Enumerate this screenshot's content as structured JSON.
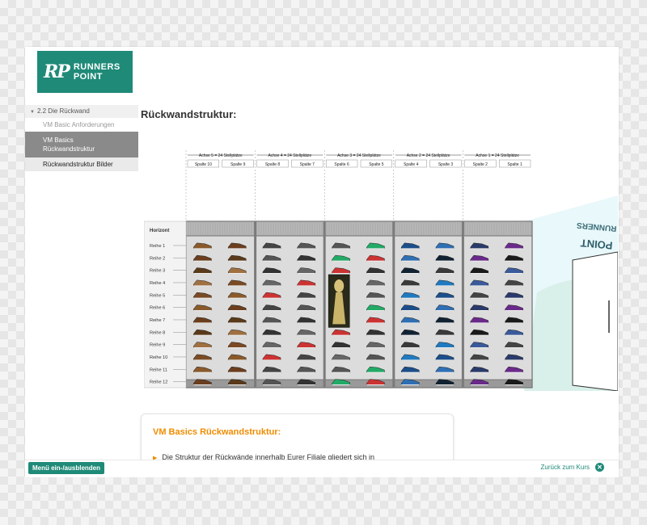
{
  "brand": {
    "mark": "RP",
    "line1": "RUNNERS",
    "line2": "POINT",
    "color": "#1f8a78"
  },
  "sidebar": {
    "section": "2.2 Die Rückwand",
    "items": [
      {
        "label": "VM Basic Anforderungen",
        "state": "normal"
      },
      {
        "label_lines": [
          "VM Basics",
          "Rückwandstruktur"
        ],
        "state": "active"
      },
      {
        "label": "Rückwandstruktur Bilder",
        "state": "sub"
      }
    ]
  },
  "page_title": "Rückwandstruktur:",
  "diagram": {
    "axes": [
      {
        "label": "Achse 5 = 24 Stellplätze",
        "columns": [
          "Spalte 10",
          "Spalte 9"
        ]
      },
      {
        "label": "Achse 4 = 24 Stellplätze",
        "columns": [
          "Spalte 8",
          "Spalte 7"
        ]
      },
      {
        "label": "Achse 3 = 24 Stellplätze",
        "columns": [
          "Spalte 6",
          "Spalte 5"
        ]
      },
      {
        "label": "Achse 2 = 24 Stellplätze",
        "columns": [
          "Spalte 4",
          "Spalte 3"
        ]
      },
      {
        "label": "Achse 1 = 24 Stellplätze",
        "columns": [
          "Spalte 2",
          "Spalte 1"
        ]
      }
    ],
    "horizont_label": "Horizont",
    "rows": [
      "Reihe 1",
      "Reihe 2",
      "Reihe 3",
      "Reihe 4",
      "Reihe 5",
      "Reihe 6",
      "Reihe 7",
      "Reihe 8",
      "Reihe 9",
      "Reihe 10",
      "Reihe 11",
      "Reihe 12"
    ],
    "store_sign_lines": [
      "RUNNERS",
      "POINT"
    ]
  },
  "info_box": {
    "title": "VM Basics Rückwandstruktur:",
    "text": "Die Struktur der Rückwände innerhalb Eurer Filiale gliedert sich in"
  },
  "footer": {
    "menu_toggle": "Menü ein-/ausblenden",
    "back_link": "Zurück zum Kurs",
    "close_glyph": "✕"
  },
  "colors": {
    "accent": "#1f8a78",
    "heading_orange": "#f08c00",
    "sidebar_active": "#8a8a8a"
  }
}
